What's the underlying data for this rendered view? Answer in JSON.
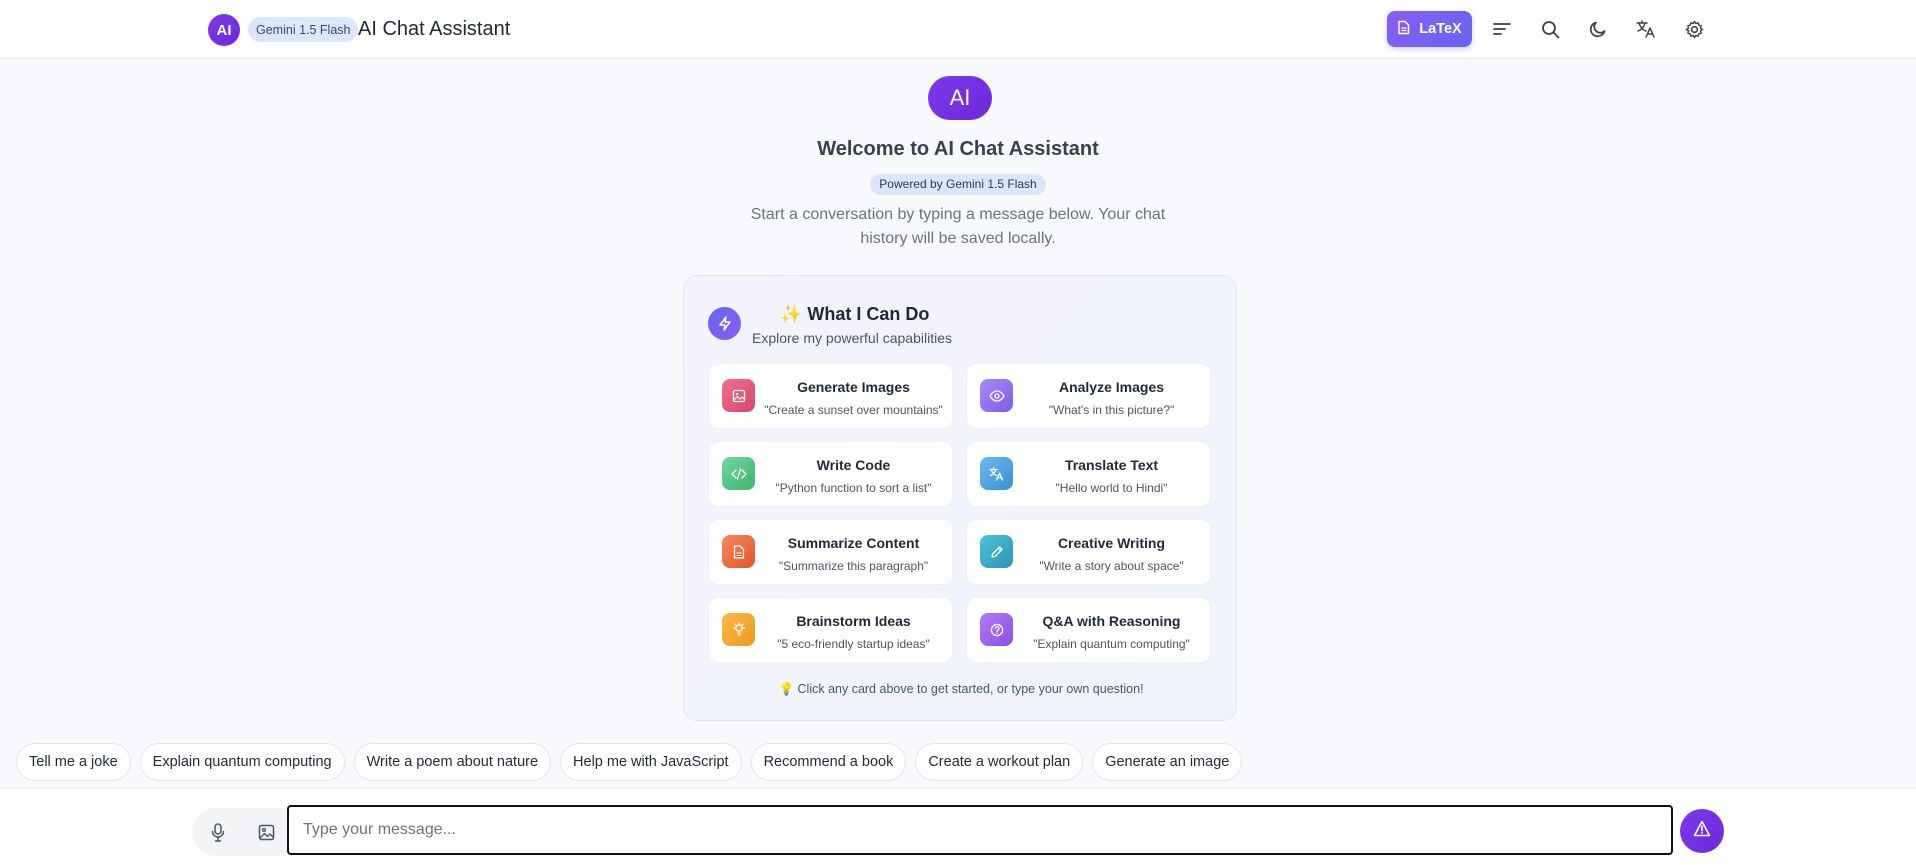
{
  "header": {
    "avatar_text": "AI",
    "model_badge": "Gemini 1.5 Flash",
    "title": "AI Chat Assistant",
    "latex_label": "LaTeX",
    "icons": [
      "menu-lines-icon",
      "search-icon",
      "moon-icon",
      "translate-icon",
      "gear-icon"
    ]
  },
  "welcome": {
    "logo_text": "AI",
    "title": "Welcome to AI Chat Assistant",
    "badge": "Powered by Gemini 1.5 Flash",
    "subtitle": "Start a conversation by typing a message below. Your chat history will be saved locally."
  },
  "capabilities": {
    "emoji": "✨",
    "title": "What I Can Do",
    "subtitle": "Explore my powerful capabilities",
    "cards": [
      {
        "title": "Generate Images",
        "example": "\"Create a sunset over mountains\"",
        "icon": "image-icon",
        "color": "#e25576"
      },
      {
        "title": "Analyze Images",
        "example": "\"What's in this picture?\"",
        "icon": "eye-icon",
        "color": "#8b6cf0"
      },
      {
        "title": "Write Code",
        "example": "\"Python function to sort a list\"",
        "icon": "code-icon",
        "color": "#4cc479"
      },
      {
        "title": "Translate Text",
        "example": "\"Hello world to Hindi\"",
        "icon": "translate-icon",
        "color": "#4ea3e6"
      },
      {
        "title": "Summarize Content",
        "example": "\"Summarize this paragraph\"",
        "icon": "document-icon",
        "color": "#ee6a3f"
      },
      {
        "title": "Creative Writing",
        "example": "\"Write a story about space\"",
        "icon": "pencil-icon",
        "color": "#33a9c4"
      },
      {
        "title": "Brainstorm Ideas",
        "example": "\"5 eco-friendly startup ideas\"",
        "icon": "lightbulb-icon",
        "color": "#f2a42c"
      },
      {
        "title": "Q&A with Reasoning",
        "example": "\"Explain quantum computing\"",
        "icon": "question-icon",
        "color": "#9a63ee"
      }
    ],
    "tip_emoji": "💡",
    "tip": "Click any card above to get started, or type your own question!"
  },
  "quick_prompts": [
    "Tell me a joke",
    "Explain quantum computing",
    "Write a poem about nature",
    "Help me with JavaScript",
    "Recommend a book",
    "Create a workout plan",
    "Generate an image"
  ],
  "composer": {
    "placeholder": "Type your message...",
    "value": ""
  }
}
